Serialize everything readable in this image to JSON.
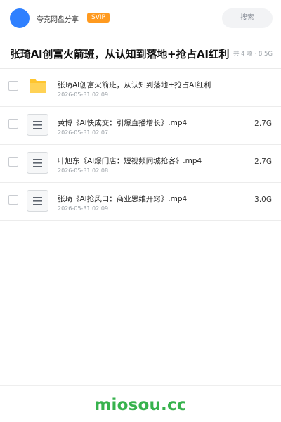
{
  "header": {
    "brand": "夸克网盘分享",
    "vip_badge": "SVIP",
    "search_label": "搜索"
  },
  "folder": {
    "title": "张琦AI创富火箭班，从认知到落地+抢占AI红利",
    "meta": "共 4 项 · 8.5G"
  },
  "files": [
    {
      "name": "张琦AI创富火箭班，从认知到落地+抢占AI红利",
      "date": "2026-05-31 02:09",
      "size": "",
      "type": "folder"
    },
    {
      "name": "黄博《AI快成交：引爆直播增长》.mp4",
      "date": "2026-05-31 02:07",
      "size": "2.7G",
      "type": "video"
    },
    {
      "name": "叶旭东《AI爆门店：短视频同城抢客》.mp4",
      "date": "2026-05-31 02:08",
      "size": "2.7G",
      "type": "video"
    },
    {
      "name": "张琦《AI抢风口：商业思维开窍》.mp4",
      "date": "2026-05-31 02:09",
      "size": "3.0G",
      "type": "video"
    }
  ],
  "footer": {
    "watermark": "miosou.cc"
  },
  "colors": {
    "accent_blue": "#2f80ff",
    "vip_orange": "#ff9a1f",
    "folder_yellow": "#ffc52e",
    "watermark_green": "#37b24d"
  }
}
